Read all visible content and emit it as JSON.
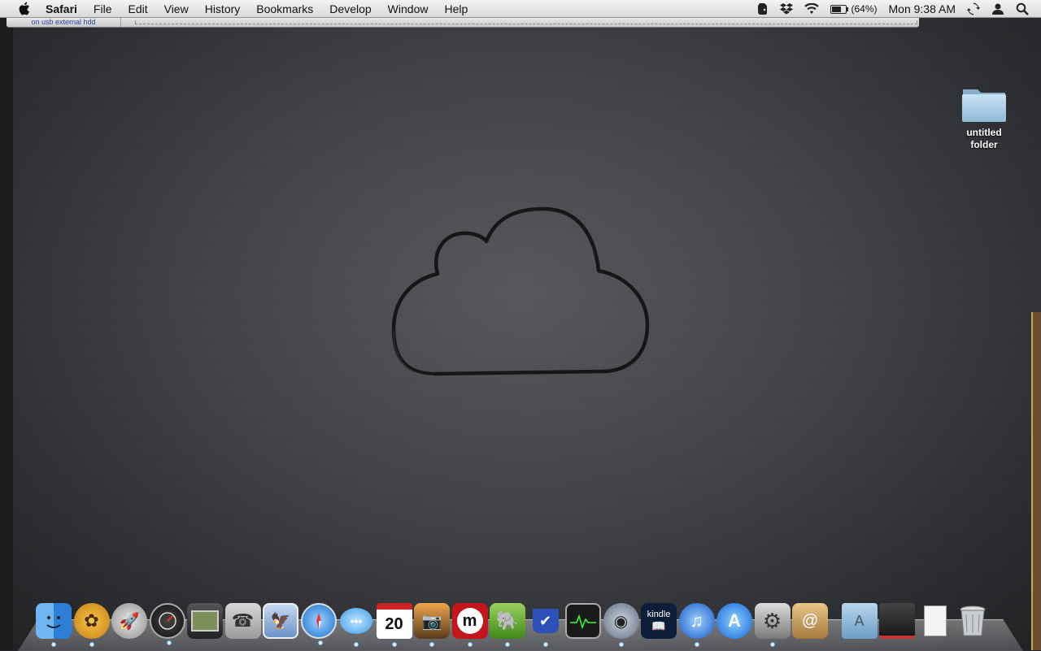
{
  "menubar": {
    "app_name": "Safari",
    "menus": [
      "File",
      "Edit",
      "View",
      "History",
      "Bookmarks",
      "Develop",
      "Window",
      "Help"
    ],
    "status": {
      "battery_percent": "(64%)",
      "clock": "Mon 9:38 AM"
    }
  },
  "safari_strip": {
    "tab_label": "on usb external hdd"
  },
  "desktop": {
    "folder_label_line1": "untitled",
    "folder_label_line2": "folder"
  },
  "dock": {
    "items": [
      "finder-icon",
      "gnome-icon",
      "launchpad-icon",
      "dashboard-icon",
      "photo-booth-icon",
      "phone-icon",
      "mail-icon",
      "safari-icon",
      "messages-icon",
      "calendar-icon",
      "iphoto-icon",
      "mendeley-icon",
      "evernote-icon",
      "todo-mug-icon",
      "activity-monitor-icon",
      "quicktime-icon",
      "kindle-icon",
      "itunes-icon",
      "app-store-icon",
      "system-preferences-icon",
      "address-book-icon",
      "applications-folder-icon",
      "downloads-stack-icon",
      "document-icon",
      "trash-icon"
    ],
    "calendar_day": "20",
    "kindle_label": "kindle"
  }
}
